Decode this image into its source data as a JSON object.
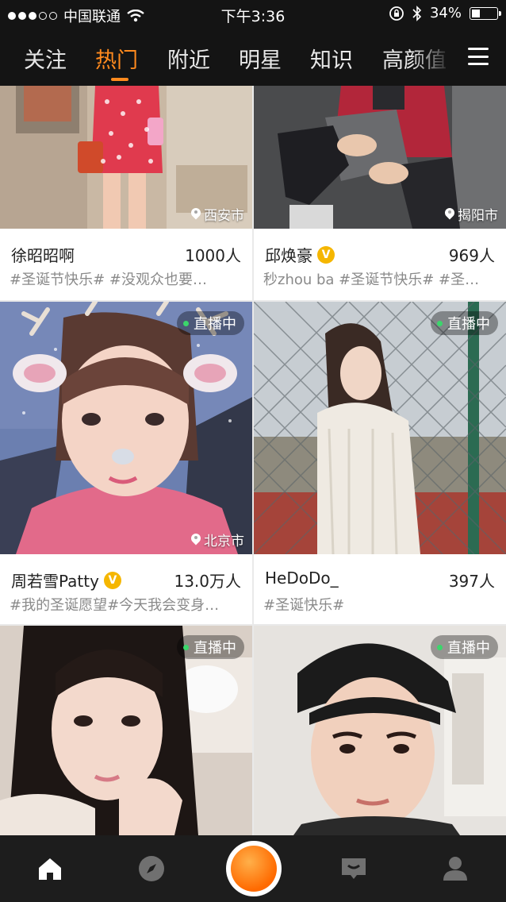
{
  "status_bar": {
    "carrier": "中国联通",
    "time": "下午3:36",
    "battery": "34%",
    "battery_level": 0.34
  },
  "nav": {
    "tabs": [
      "关注",
      "热门",
      "附近",
      "明星",
      "知识",
      "高颜值"
    ],
    "active_tab": "热门"
  },
  "cards": [
    {
      "name": "徐昭昭啊",
      "verified": false,
      "count": "1000人",
      "tags": "#圣诞节快乐# #没观众也要…",
      "location": "西安市",
      "live": false
    },
    {
      "name": "邱焕豪",
      "verified": true,
      "count": "969人",
      "tags": "秒zhou ba #圣诞节快乐# #圣…",
      "location": "揭阳市",
      "live": false
    },
    {
      "name": "周若雪Patty",
      "verified": true,
      "count": "13.0万人",
      "tags": "#我的圣诞愿望#今天我会变身…",
      "location": "北京市",
      "live": true
    },
    {
      "name": "HeDoDo_",
      "verified": false,
      "count": "397人",
      "tags": "#圣诞快乐#",
      "location": "",
      "live": true
    },
    {
      "name": "",
      "verified": false,
      "count": "",
      "tags": "",
      "location": "",
      "live": true
    },
    {
      "name": "",
      "verified": false,
      "count": "",
      "tags": "",
      "location": "",
      "live": true
    }
  ],
  "live_label": "直播中",
  "bottom_nav": [
    "home-icon",
    "compass-icon",
    "record-button",
    "message-icon",
    "profile-icon"
  ],
  "colors": {
    "accent": "#ff8a1e",
    "live_dot": "#3bd66b",
    "verified": "#f5b600"
  }
}
